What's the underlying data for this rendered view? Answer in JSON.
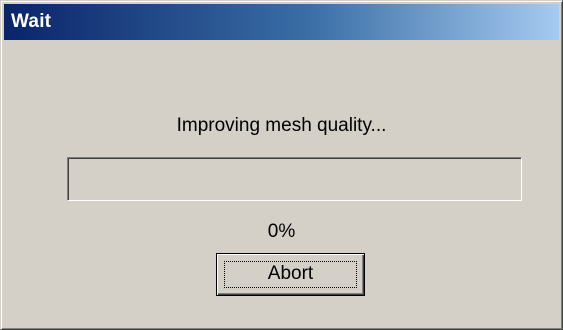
{
  "window": {
    "title": "Wait"
  },
  "message": "Improving mesh quality...",
  "progress": {
    "percent_label": "0%",
    "value": 0
  },
  "buttons": {
    "abort_label": "Abort"
  },
  "colors": {
    "dialog_face": "#d4d0c8",
    "titlebar_start": "#0a246a",
    "titlebar_end": "#a6caf0",
    "title_text": "#ffffff"
  }
}
